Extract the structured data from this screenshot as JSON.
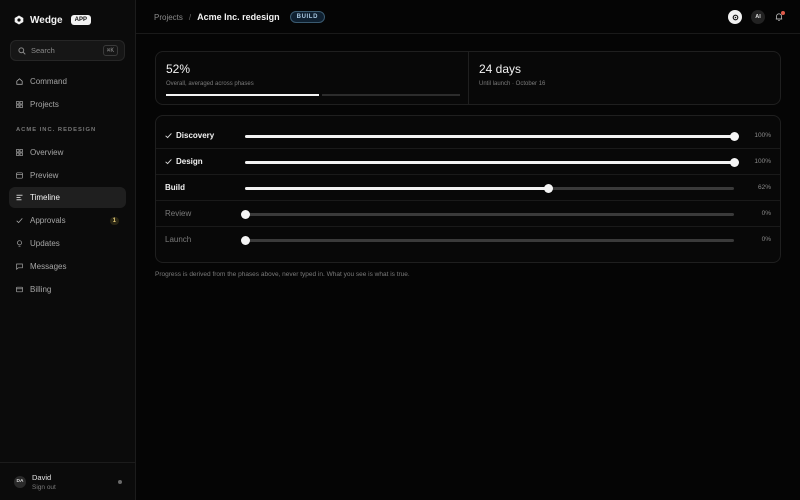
{
  "brand": {
    "name": "Wedge",
    "badge": "APP"
  },
  "search": {
    "placeholder": "Search",
    "shortcut": "⌘K"
  },
  "nav_top": [
    {
      "label": "Command",
      "icon": "home-icon"
    },
    {
      "label": "Projects",
      "icon": "grid-icon"
    }
  ],
  "project_section_label": "ACME INC. REDESIGN",
  "nav_project": [
    {
      "label": "Overview",
      "icon": "grid-icon",
      "active": false
    },
    {
      "label": "Preview",
      "icon": "browser-icon",
      "active": false
    },
    {
      "label": "Timeline",
      "icon": "timeline-icon",
      "active": true
    },
    {
      "label": "Approvals",
      "icon": "check-icon",
      "active": false,
      "count": "1"
    },
    {
      "label": "Updates",
      "icon": "bulb-icon",
      "active": false
    },
    {
      "label": "Messages",
      "icon": "chat-icon",
      "active": false
    },
    {
      "label": "Billing",
      "icon": "card-icon",
      "active": false
    }
  ],
  "user": {
    "initials": "DA",
    "name": "David",
    "action": "Sign out"
  },
  "breadcrumb": {
    "root": "Projects",
    "separator": "/",
    "current": "Acme Inc. redesign",
    "status": "BUILD"
  },
  "top_actions": {
    "ai_label": "AI"
  },
  "summary": {
    "progress_value": "52%",
    "progress_caption": "Overall, averaged across phases",
    "progress_fraction": 0.52,
    "days_value": "24 days",
    "days_caption": "Until launch · October 16"
  },
  "phases": [
    {
      "name": "Discovery",
      "percent_label": "100%",
      "value": 1.0,
      "state": "done"
    },
    {
      "name": "Design",
      "percent_label": "100%",
      "value": 1.0,
      "state": "done"
    },
    {
      "name": "Build",
      "percent_label": "62%",
      "value": 0.62,
      "state": "current"
    },
    {
      "name": "Review",
      "percent_label": "0%",
      "value": 0.0,
      "state": "todo"
    },
    {
      "name": "Launch",
      "percent_label": "0%",
      "value": 0.0,
      "state": "todo"
    }
  ],
  "footnote": "Progress is derived from the phases above, never typed in. What you see is what is true.",
  "colors": {
    "background": "#050505",
    "accent": "#f2f2f2",
    "badge_blue": "#a8c7e0",
    "notify_red": "#e05a4a"
  }
}
